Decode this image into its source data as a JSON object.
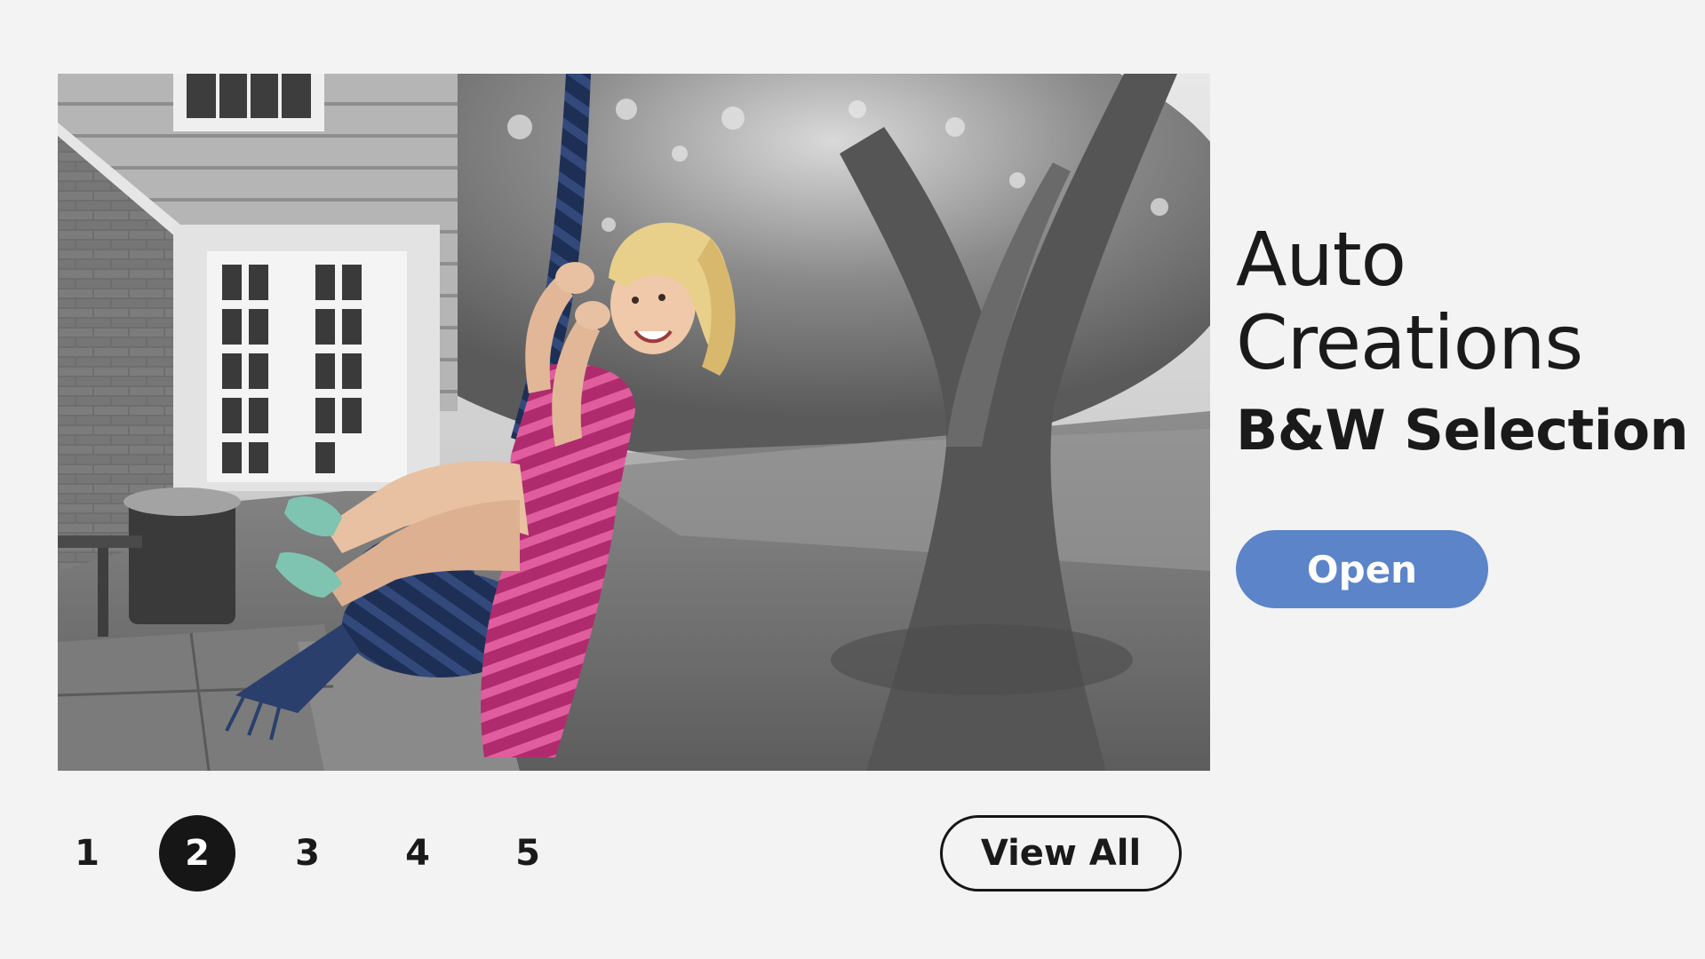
{
  "hero": {
    "image_name": "girl-on-rope-swing-photo",
    "effect": "black-and-white with color pop"
  },
  "info": {
    "title_line1": "Auto",
    "title_line2": "Creations",
    "subtitle": "B&W Selection",
    "open_label": "Open"
  },
  "pager": {
    "pages": [
      "1",
      "2",
      "3",
      "4",
      "5"
    ],
    "active": "2"
  },
  "view_all_label": "View All",
  "colors": {
    "background": "#f3f3f3",
    "accent": "#5b84c9",
    "active_page": "#161616",
    "dress": "#c4357a",
    "rope": "#22365f"
  }
}
